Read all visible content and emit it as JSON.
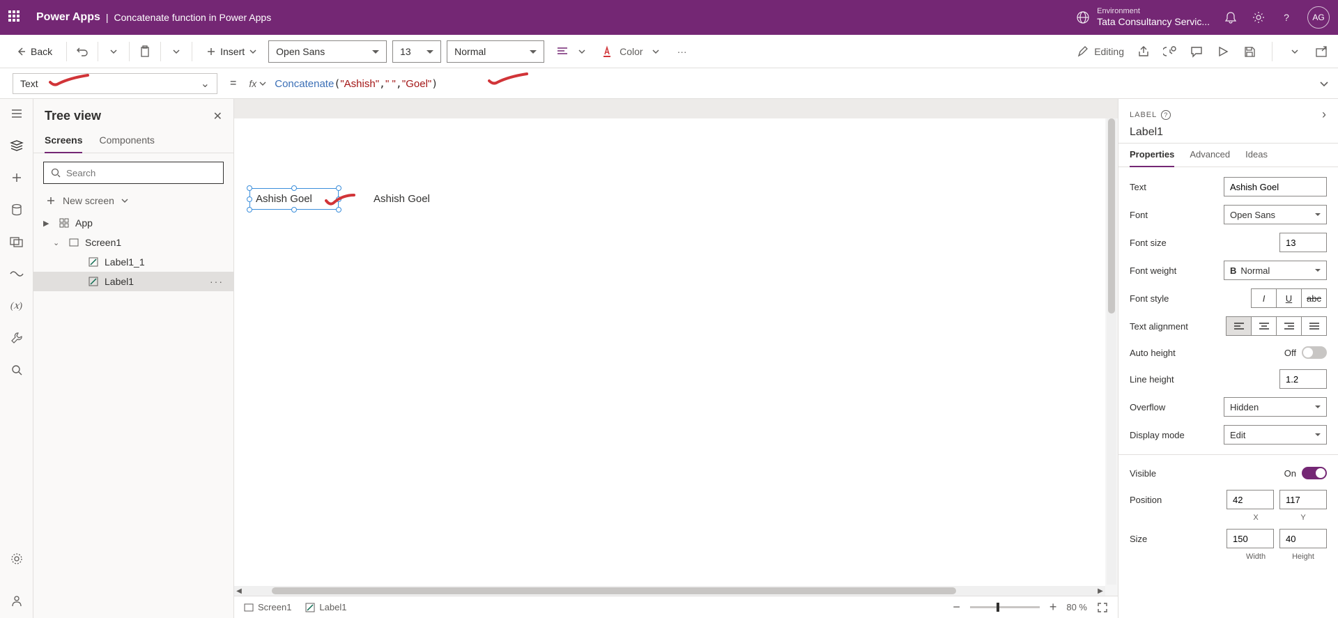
{
  "header": {
    "app": "Power Apps",
    "page": "Concatenate function in Power Apps",
    "env_label": "Environment",
    "env_name": "Tata Consultancy Servic...",
    "avatar": "AG"
  },
  "toolbar": {
    "back": "Back",
    "insert": "Insert",
    "font": "Open Sans",
    "font_size": "13",
    "font_weight": "Normal",
    "color": "Color",
    "editing": "Editing"
  },
  "formula": {
    "property": "Text",
    "fn": "Concatenate",
    "arg1": "\"Ashish\"",
    "arg2": "\" \"",
    "arg3": "\"Goel\""
  },
  "tree": {
    "title": "Tree view",
    "tab_screens": "Screens",
    "tab_components": "Components",
    "search_placeholder": "Search",
    "new_screen": "New screen",
    "items": {
      "app": "App",
      "screen1": "Screen1",
      "label1_1": "Label1_1",
      "label1": "Label1"
    }
  },
  "canvas": {
    "label_selected": "Ashish Goel",
    "label_plain": "Ashish Goel",
    "status_screen": "Screen1",
    "status_label": "Label1",
    "zoom": "80 %"
  },
  "props": {
    "type_label": "LABEL",
    "name": "Label1",
    "tab_properties": "Properties",
    "tab_advanced": "Advanced",
    "tab_ideas": "Ideas",
    "rows": {
      "text_label": "Text",
      "text_value": "Ashish Goel",
      "font_label": "Font",
      "font_value": "Open Sans",
      "fontsize_label": "Font size",
      "fontsize_value": "13",
      "fontweight_label": "Font weight",
      "fontweight_value": "Normal",
      "fontstyle_label": "Font style",
      "align_label": "Text alignment",
      "autoheight_label": "Auto height",
      "autoheight_value": "Off",
      "lineheight_label": "Line height",
      "lineheight_value": "1.2",
      "overflow_label": "Overflow",
      "overflow_value": "Hidden",
      "displaymode_label": "Display mode",
      "displaymode_value": "Edit",
      "visible_label": "Visible",
      "visible_value": "On",
      "position_label": "Position",
      "position_x": "42",
      "position_y": "117",
      "position_xlabel": "X",
      "position_ylabel": "Y",
      "size_label": "Size",
      "size_w": "150",
      "size_h": "40",
      "size_wlabel": "Width",
      "size_hlabel": "Height"
    }
  }
}
